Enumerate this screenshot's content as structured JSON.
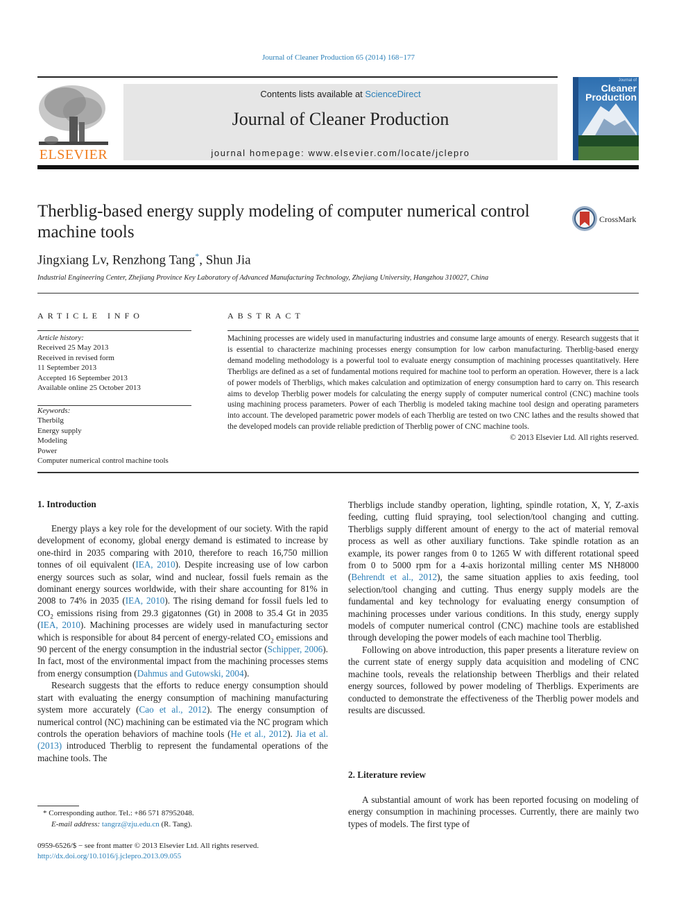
{
  "header": {
    "citation": "Journal of Cleaner Production 65 (2014) 168−177",
    "contents_prefix": "Contents lists available at ",
    "contents_link": "ScienceDirect",
    "journal_name": "Journal of Cleaner Production",
    "homepage": "journal homepage: www.elsevier.com/locate/jclepro",
    "publisher_logo_text": "ELSEVIER",
    "cover_title_line1": "Cleaner",
    "cover_title_line2": "Production",
    "cover_small": "Journal of"
  },
  "article": {
    "title": "Therblig-based energy supply modeling of computer numerical control machine tools",
    "crossmark_label": "CrossMark",
    "authors": [
      {
        "name": "Jingxiang Lv",
        "sep": ", "
      },
      {
        "name": "Renzhong Tang",
        "mark": "*",
        "sep": ", "
      },
      {
        "name": "Shun Jia",
        "sep": ""
      }
    ],
    "affiliation": "Industrial Engineering Center, Zhejiang Province Key Laboratory of Advanced Manufacturing Technology, Zhejiang University, Hangzhou 310027, China"
  },
  "article_info": {
    "heading": "ARTICLE INFO",
    "history_label": "Article history:",
    "history": [
      "Received 25 May 2013",
      "Received in revised form",
      "11 September 2013",
      "Accepted 16 September 2013",
      "Available online 25 October 2013"
    ],
    "keywords_label": "Keywords:",
    "keywords": [
      "Therbilg",
      "Energy supply",
      "Modeling",
      "Power",
      "Computer numerical control machine tools"
    ]
  },
  "abstract": {
    "heading": "ABSTRACT",
    "text": "Machining processes are widely used in manufacturing industries and consume large amounts of energy. Research suggests that it is essential to characterize machining processes energy consumption for low carbon manufacturing. Therblig-based energy demand modeling methodology is a powerful tool to evaluate energy consumption of machining processes quantitatively. Here Therbligs are defined as a set of fundamental motions required for machine tool to perform an operation. However, there is a lack of power models of Therbligs, which makes calculation and optimization of energy consumption hard to carry on. This research aims to develop Therblig power models for calculating the energy supply of computer numerical control (CNC) machine tools using machining process parameters. Power of each Therblig is modeled taking machine tool design and operating parameters into account. The developed parametric power models of each Therblig are tested on two CNC lathes and the results showed that the developed models can provide reliable prediction of Therblig power of CNC machine tools.",
    "copyright": "© 2013 Elsevier Ltd. All rights reserved."
  },
  "sections": {
    "intro_heading": "1.  Introduction",
    "p1": [
      {
        "t": "Energy plays a key role for the development of our society. With the rapid development of economy, global energy demand is estimated to increase by one-third in 2035 comparing with 2010, therefore to reach 16,750 million tonnes of oil equivalent ("
      },
      {
        "link": "IEA, 2010"
      },
      {
        "t": "). Despite increasing use of low carbon energy sources such as solar, wind and nuclear, fossil fuels remain as the dominant energy sources worldwide, with their share accounting for 81% in 2008 to 74% in 2035 ("
      },
      {
        "link": "IEA, 2010"
      },
      {
        "t": "). The rising demand for fossil fuels led to CO"
      },
      {
        "sub": "2"
      },
      {
        "t": " emissions rising from 29.3 gigatonnes (Gt) in 2008 to 35.4 Gt in 2035 ("
      },
      {
        "link": "IEA, 2010"
      },
      {
        "t": "). Machining processes are widely used in manufacturing sector which is responsible for about 84 percent of energy-related CO"
      },
      {
        "sub": "2"
      },
      {
        "t": " emissions and 90 percent of the energy consumption in the industrial sector ("
      },
      {
        "link": "Schipper, 2006"
      },
      {
        "t": "). In fact, most of the environmental impact from the machining processes stems from energy consumption ("
      },
      {
        "link": "Dahmus and Gutowski, 2004"
      },
      {
        "t": ")."
      }
    ],
    "p2": [
      {
        "t": "Research suggests that the efforts to reduce energy consumption should start with evaluating the energy consumption of machining manufacturing system more accurately ("
      },
      {
        "link": "Cao et al., 2012"
      },
      {
        "t": "). The energy consumption of numerical control (NC) machining can be estimated via the NC program which controls the operation behaviors of machine tools ("
      },
      {
        "link": "He et al., 2012"
      },
      {
        "t": "). "
      },
      {
        "link": "Jia et al. (2013)"
      },
      {
        "t": " introduced Therblig to represent the fundamental operations of the machine tools. The"
      }
    ],
    "p3": [
      {
        "t": "Therbligs include standby operation, lighting, spindle rotation, X, Y, Z-axis feeding, cutting fluid spraying, tool selection/tool changing and cutting. Therbligs supply different amount of energy to the act of material removal process as well as other auxiliary functions. Take spindle rotation as an example, its power ranges from 0 to 1265 W with different rotational speed from 0 to 5000 rpm for a 4-axis horizontal milling center MS NH8000 ("
      },
      {
        "link": "Behrendt et al., 2012"
      },
      {
        "t": "), the same situation applies to axis feeding, tool selection/tool changing and cutting. Thus energy supply models are the fundamental and key technology for evaluating energy consumption of machining processes under various conditions. In this study, energy supply models of computer numerical control (CNC) machine tools are established through developing the power models of each machine tool Therblig."
      }
    ],
    "p4": [
      {
        "t": "Following on above introduction, this paper presents a literature review on the current state of energy supply data acquisition and modeling of CNC machine tools, reveals the relationship between Therbligs and their related energy sources, followed by power modeling of Therbligs. Experiments are conducted to demonstrate the effectiveness of the Therblig power models and results are discussed."
      }
    ],
    "lit_heading": "2.  Literature review",
    "p5": [
      {
        "t": "A substantial amount of work has been reported focusing on modeling of energy consumption in machining processes. Currently, there are mainly two types of models. The first type of"
      }
    ]
  },
  "footnote": {
    "corresponding": "* Corresponding author. Tel.: +86 571 87952048.",
    "email_label": "E-mail address: ",
    "email": "tangrz@zju.edu.cn",
    "email_suffix": " (R. Tang).",
    "issn_line": "0959-6526/$ − see front matter © 2013 Elsevier Ltd. All rights reserved.",
    "doi": "http://dx.doi.org/10.1016/j.jclepro.2013.09.055"
  },
  "colors": {
    "link": "#2a7fb8",
    "elsevier_orange": "#f07c1c",
    "masthead_bg": "#e6e6e6"
  }
}
